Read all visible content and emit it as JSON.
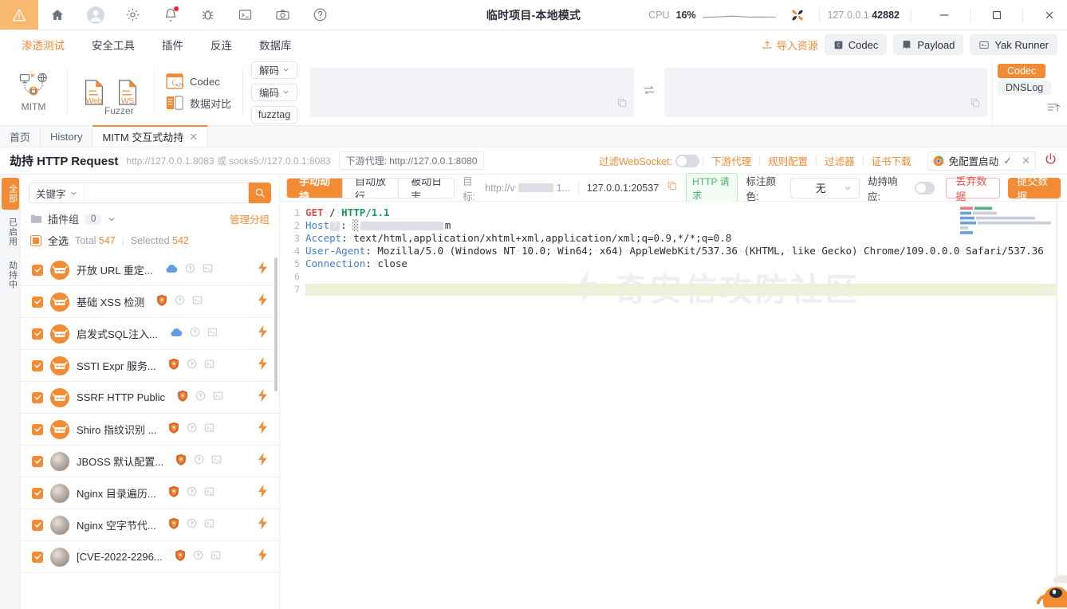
{
  "titlebar": {
    "title": "临时项目-本地模式",
    "cpu_label": "CPU",
    "cpu_value": "16%",
    "addr_host": "127.0.0.1",
    "addr_port": "42882",
    "icons": [
      {
        "name": "warning-icon",
        "glyph": "⚠"
      },
      {
        "name": "home-icon",
        "glyph": "⌂"
      },
      {
        "name": "user-avatar-icon",
        "glyph": "◍"
      },
      {
        "name": "settings-gear-icon",
        "glyph": "⚙"
      },
      {
        "name": "notification-bell-icon",
        "glyph": "🔔"
      },
      {
        "name": "bug-icon",
        "glyph": "🐞"
      },
      {
        "name": "terminal-icon",
        "glyph": ">_"
      },
      {
        "name": "camera-icon",
        "glyph": "📷"
      },
      {
        "name": "help-icon",
        "glyph": "?"
      }
    ],
    "window_controls": {
      "minimize": "—",
      "maximize": "□",
      "close": "✕"
    }
  },
  "menubar": {
    "items": [
      {
        "label": "渗透测试",
        "active": true
      },
      {
        "label": "安全工具",
        "active": false
      },
      {
        "label": "插件",
        "active": false
      },
      {
        "label": "反连",
        "active": false
      },
      {
        "label": "数据库",
        "active": false
      }
    ],
    "import_resource": "导入资源",
    "quick_buttons": [
      {
        "label": "Codec",
        "icon": "codec-icon"
      },
      {
        "label": "Payload",
        "icon": "payload-icon"
      },
      {
        "label": "Yak Runner",
        "icon": "terminal-icon"
      }
    ]
  },
  "ribbon": {
    "mitm_label": "MITM",
    "fuzzer_label": "Fuzzer",
    "fuzzer_web": "Web",
    "fuzzer_ws": "WS",
    "codec_label": "Codec",
    "compare_label": "数据对比",
    "decode_label": "解码",
    "encode_label": "编码",
    "fuzztag_label": "fuzztag",
    "input_left_value": "",
    "input_right_value": "",
    "right_tabs": [
      {
        "label": "Codec",
        "active": true
      },
      {
        "label": "DNSLog",
        "active": false
      }
    ]
  },
  "page_tabs": [
    {
      "label": "首页",
      "active": false,
      "closable": false
    },
    {
      "label": "History",
      "active": false,
      "closable": false
    },
    {
      "label": "MITM 交互式劫持",
      "active": true,
      "closable": true,
      "close_glyph": "✕"
    }
  ],
  "mitm_header": {
    "title": "劫持 HTTP Request",
    "subtitle": "http://127.0.0.1:8083 或 socks5://127.0.0.1:8083",
    "downstream_pill": "下游代理: http://127.0.0.1:8080",
    "filter_ws_label": "过滤WebSocket:",
    "filter_ws_on": false,
    "links": [
      "下游代理",
      "规则配置",
      "过滤器",
      "证书下载"
    ],
    "start_label": "免配置启动",
    "start_check": "✓",
    "start_close": "✕",
    "power_icon": "power-icon"
  },
  "plugin_panel": {
    "vertical_tabs": [
      {
        "label": "全部",
        "active": true
      },
      {
        "label": "已启用",
        "active": false
      },
      {
        "label": "劫持中",
        "active": false
      }
    ],
    "search_kind": "关键字",
    "search_value": "",
    "search_placeholder": "",
    "group_label": "插件组",
    "group_count": "0",
    "manage_label": "管理分组",
    "select_all_label": "全选",
    "total_label": "Total",
    "total_value": "547",
    "selected_label": "Selected",
    "selected_value": "542",
    "items": [
      {
        "name": "开放 URL 重定...",
        "checked": true,
        "avatar": "logo",
        "type_icon": "cloud-icon"
      },
      {
        "name": "基础 XSS 检测",
        "checked": true,
        "avatar": "logo",
        "type_icon": "shield-icon"
      },
      {
        "name": "启发式SQL注入...",
        "checked": true,
        "avatar": "logo",
        "type_icon": "cloud-icon"
      },
      {
        "name": "SSTI Expr 服务...",
        "checked": true,
        "avatar": "logo",
        "type_icon": "shield-icon"
      },
      {
        "name": "SSRF HTTP Public",
        "checked": true,
        "avatar": "logo",
        "type_icon": "shield-icon"
      },
      {
        "name": "Shiro 指纹识别 ...",
        "checked": true,
        "avatar": "logo",
        "type_icon": "shield-icon"
      },
      {
        "name": "JBOSS 默认配置...",
        "checked": true,
        "avatar": "photo",
        "type_icon": "shield-icon"
      },
      {
        "name": "Nginx 目录遍历...",
        "checked": true,
        "avatar": "photo",
        "type_icon": "shield-icon"
      },
      {
        "name": "Nginx 空字节代...",
        "checked": true,
        "avatar": "photo",
        "type_icon": "shield-icon"
      },
      {
        "name": "[CVE-2022-2296...",
        "checked": true,
        "avatar": "photo",
        "type_icon": "shield-icon"
      }
    ]
  },
  "action_bar": {
    "segments": [
      {
        "label": "手动劫持",
        "active": true
      },
      {
        "label": "自动放行",
        "active": false
      },
      {
        "label": "被动日志",
        "active": false
      }
    ],
    "target_label": "目标:",
    "target_value": "http://v",
    "target_suffix": "1...",
    "remote_addr": "127.0.0.1:20537",
    "copy_icon": "copy-icon",
    "http_badge": "HTTP 请求",
    "color_label": "标注颜色:",
    "color_value": "无",
    "hijack_resp_label": "劫持响应:",
    "hijack_resp_on": false,
    "discard_label": "丢弃数据",
    "submit_label": "提交数据"
  },
  "editor": {
    "line_numbers": [
      "1",
      "2",
      "3",
      "4",
      "5",
      "6",
      "7"
    ],
    "watermark": "奇安信攻防社区",
    "lines": [
      {
        "n": "1",
        "method": "GET",
        "path": "/",
        "proto": "HTTP/1.1"
      },
      {
        "n": "2",
        "header": "Host",
        "folded": true,
        "value_redacted": true,
        "value_tail": "m"
      },
      {
        "n": "3",
        "header": "Accept",
        "value": "text/html,application/xhtml+xml,application/xml;q=0.9,*/*;q=0.8"
      },
      {
        "n": "4",
        "header": "User-Agent",
        "value": "Mozilla/5.0 (Windows NT 10.0; Win64; x64) AppleWebKit/537.36 (KHTML, like Gecko) Chrome/109.0.0.0 Safari/537.36"
      },
      {
        "n": "5",
        "header": "Connection",
        "value": "close"
      },
      {
        "n": "6",
        "value": ""
      },
      {
        "n": "7",
        "value": "",
        "highlight": true
      }
    ]
  }
}
